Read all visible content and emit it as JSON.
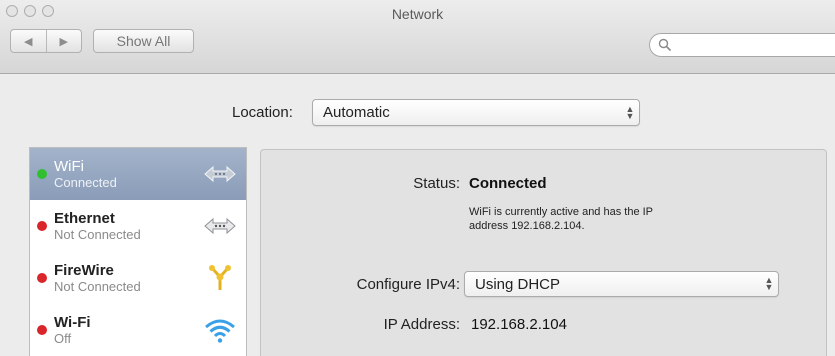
{
  "window": {
    "title": "Network"
  },
  "toolbar": {
    "back_label": "◀",
    "forward_label": "▶",
    "show_all_label": "Show All",
    "search": {
      "value": "",
      "placeholder": ""
    }
  },
  "location": {
    "label": "Location:",
    "value": "Automatic"
  },
  "services": [
    {
      "name": "WiFi",
      "status": "Connected",
      "status_color": "#2fbf2f",
      "icon": "wifi-arrows-icon",
      "selected": true
    },
    {
      "name": "Ethernet",
      "status": "Not Connected",
      "status_color": "#d9262a",
      "icon": "ethernet-arrows-icon",
      "selected": false
    },
    {
      "name": "FireWire",
      "status": "Not Connected",
      "status_color": "#d9262a",
      "icon": "firewire-icon",
      "selected": false
    },
    {
      "name": "Wi-Fi",
      "status": "Off",
      "status_color": "#d9262a",
      "icon": "wifi-signal-icon",
      "selected": false
    }
  ],
  "detail": {
    "status_label": "Status:",
    "status_value": "Connected",
    "status_note_line1": "WiFi is currently active and has the IP",
    "status_note_line2": "address 192.168.2.104.",
    "ipv4_label": "Configure IPv4:",
    "ipv4_value": "Using DHCP",
    "ip_label": "IP Address:",
    "ip_value": "192.168.2.104"
  },
  "colors": {
    "selection": "#8a9cb8",
    "connected": "#2fbf2f",
    "disconnected": "#d9262a"
  }
}
